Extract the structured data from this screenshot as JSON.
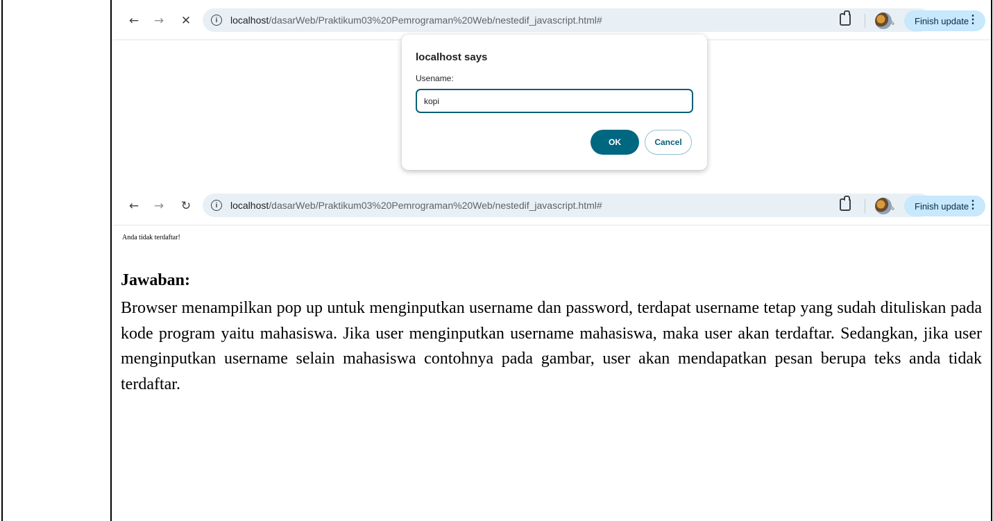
{
  "browser_top": {
    "url_host": "localhost",
    "url_path": "/dasarWeb/Praktikum03%20Pemrograman%20Web/nestedif_javascript.html#",
    "update_button": "Finish update",
    "back_icon": "arrow-left-icon",
    "forward_icon": "arrow-right-icon",
    "stop_icon": "close-icon"
  },
  "dialog": {
    "title": "localhost says",
    "label": "Usename:",
    "input_value": "kopi",
    "ok_label": "OK",
    "cancel_label": "Cancel"
  },
  "browser_bottom": {
    "url_host": "localhost",
    "url_path": "/dasarWeb/Praktikum03%20Pemrograman%20Web/nestedif_javascript.html#",
    "update_button": "Finish update",
    "reload_icon": "reload-icon",
    "page_message": "Anda tidak terdaftar!"
  },
  "answer": {
    "heading": "Jawaban:",
    "body": "Browser menampilkan pop up untuk menginputkan username dan password, terdapat username tetap yang sudah dituliskan pada kode program yaitu mahasiswa. Jika user menginputkan username mahasiswa, maka user akan terdaftar. Sedangkan, jika user menginputkan username selain mahasiswa contohnya pada gambar, user akan mendapatkan pesan berupa teks anda tidak terdaftar."
  }
}
